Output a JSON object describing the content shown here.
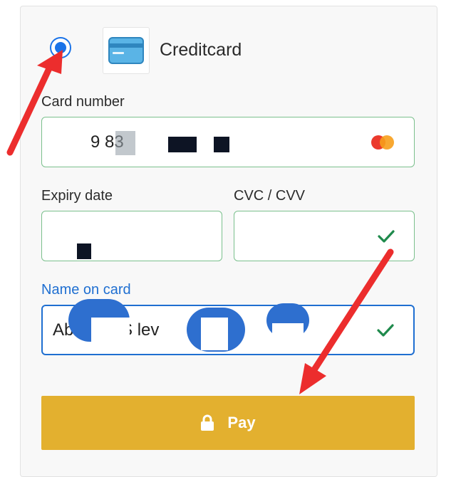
{
  "payment_method": {
    "label": "Creditcard",
    "selected": true,
    "icon": "credit-card-icon"
  },
  "card_number": {
    "label": "Card number",
    "value": "9 83",
    "brand_icon": "mastercard-icon"
  },
  "expiry": {
    "label": "Expiry date",
    "value": "",
    "valid_icon": "check-icon"
  },
  "cvc": {
    "label": "CVC / CVV",
    "value": "",
    "valid_icon": "check-icon"
  },
  "name_on_card": {
    "label": "Name on card",
    "value": "Ab  mad S lev",
    "valid_icon": "check-icon"
  },
  "pay_button": {
    "label": "Pay",
    "icon": "lock-icon"
  },
  "colors": {
    "accent_blue": "#1f6fd1",
    "valid_green": "#1f8a4c",
    "pay_yellow": "#e3b02f",
    "annotation_red": "#ec2d2d"
  }
}
